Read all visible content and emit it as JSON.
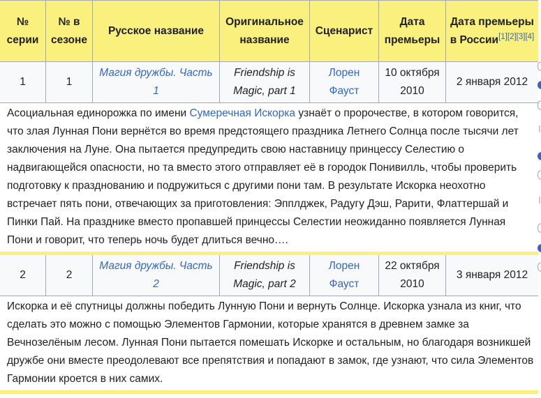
{
  "headers": {
    "series_no": "№ серии",
    "season_no": "№ в сезоне",
    "ru_title": "Русское название",
    "orig_title": "Оригинальное название",
    "writer": "Сценарист",
    "premiere": "Дата премьеры",
    "ru_premiere": "Дата премьеры в России",
    "refs": [
      "[1]",
      "[2]",
      "[3]",
      "[4]"
    ]
  },
  "episodes": [
    {
      "series_no": "1",
      "season_no": "1",
      "ru_title": "Магия дружбы. Часть 1",
      "orig_title": "Friendship is Magic, part 1",
      "writer": "Лорен Фауст",
      "premiere": "10 октября 2010",
      "ru_premiere": "2 января 2012",
      "summary": {
        "before_link": "Асоциальная единорожка по имени ",
        "link": "Сумеречная Искорка",
        "after_link": " узнаёт о пророчестве, в котором говорится, что злая Лунная Пони вернётся во время предстоящего праздника Летнего Солнца после тысячи лет заключения на Луне. Она пытается предупредить свою наставницу принцессу Селестию о надвигающейся опасности, но та вместо этого отправляет её в городок Понивилль, чтобы проверить подготовку к празднованию и подружиться с другими пони там. В результате Искорка неохотно встречает пять пони, отвечающих за приготовления: Эпплджек, Радугу Дэш, Рарити, Флаттершай и Пинки Пай. На празднике вместо пропавшей принцессы Селестии неожиданно появляется Лунная Пони и говорит, что теперь ночь будет длиться вечно…."
      }
    },
    {
      "series_no": "2",
      "season_no": "2",
      "ru_title": "Магия дружбы. Часть 2",
      "orig_title": "Friendship is Magic, part 2",
      "writer": "Лорен Фауст",
      "premiere": "22 октября 2010",
      "ru_premiere": "3 января 2012",
      "summary": {
        "text": "Искорка и её спутницы должны победить Лунную Пони и вернуть Солнце. Искорка узнала из книг, что сделать это можно с помощью Элементов Гармонии, которые хранятся в древнем замке за Вечнозелёным лесом. Лунная Пони пытается помешать Искорке и остальным, но благодаря возникшей дружбе они вместе преодолевают все препятствия и попадают в замок, где узнают, что сила Элементов Гармонии кроется в них самих."
      }
    }
  ],
  "colors": {
    "header_bg": "#f9f07e",
    "row_bg": "#f8f9fa",
    "link": "#3366cc",
    "border": "#a2a9b1"
  }
}
